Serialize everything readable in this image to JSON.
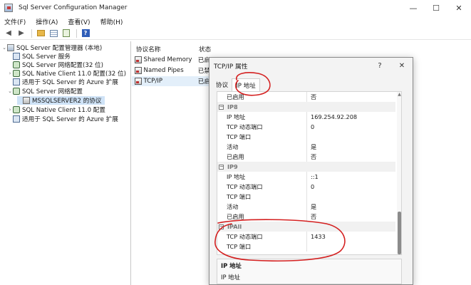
{
  "window": {
    "title": "Sql Server Configuration Manager",
    "minimize": "—",
    "maximize": "☐",
    "close": "✕"
  },
  "menu": [
    "文件(F)",
    "操作(A)",
    "查看(V)",
    "帮助(H)"
  ],
  "tree": {
    "items": [
      {
        "label": "SQL Server 配置管理器 (本地)",
        "indent": 0,
        "expander": "⌄",
        "icon": "root"
      },
      {
        "label": "SQL Server 服务",
        "indent": 1,
        "expander": "",
        "icon": "svc"
      },
      {
        "label": "SQL Server 网络配置(32 位)",
        "indent": 1,
        "expander": "",
        "icon": "net"
      },
      {
        "label": "SQL Native Client 11.0 配置(32 位)",
        "indent": 1,
        "expander": "›",
        "icon": "net"
      },
      {
        "label": "适用于 SQL Server 的 Azure 扩展",
        "indent": 1,
        "expander": "",
        "icon": "svc"
      },
      {
        "label": "SQL Server 网络配置",
        "indent": 1,
        "expander": "⌄",
        "icon": "net"
      },
      {
        "label": "MSSQLSERVER2 的协议",
        "indent": 2,
        "expander": "",
        "icon": "proto",
        "selected": true
      },
      {
        "label": "SQL Native Client 11.0 配置",
        "indent": 1,
        "expander": "›",
        "icon": "net"
      },
      {
        "label": "适用于 SQL Server 的 Azure 扩展",
        "indent": 1,
        "expander": "",
        "icon": "svc"
      }
    ]
  },
  "list": {
    "headers": {
      "name": "协议名称",
      "status": "状态"
    },
    "rows": [
      {
        "name": "Shared Memory",
        "status": "已启"
      },
      {
        "name": "Named Pipes",
        "status": "已禁"
      },
      {
        "name": "TCP/IP",
        "status": "已启"
      }
    ]
  },
  "dialog": {
    "title": "TCP/IP 属性",
    "help": "?",
    "close": "✕",
    "tabs": [
      "协议",
      "IP 地址"
    ],
    "grid": [
      {
        "type": "prop",
        "name": "已启用",
        "value": "否"
      },
      {
        "type": "cat",
        "name": "IP8",
        "toggle": "⊟"
      },
      {
        "type": "prop",
        "name": "IP 地址",
        "value": "169.254.92.208"
      },
      {
        "type": "prop",
        "name": "TCP 动态端口",
        "value": "0"
      },
      {
        "type": "prop",
        "name": "TCP 端口",
        "value": ""
      },
      {
        "type": "prop",
        "name": "活动",
        "value": "是"
      },
      {
        "type": "prop",
        "name": "已启用",
        "value": "否"
      },
      {
        "type": "cat",
        "name": "IP9",
        "toggle": "⊟"
      },
      {
        "type": "prop",
        "name": "IP 地址",
        "value": "::1"
      },
      {
        "type": "prop",
        "name": "TCP 动态端口",
        "value": "0"
      },
      {
        "type": "prop",
        "name": "TCP 端口",
        "value": ""
      },
      {
        "type": "prop",
        "name": "活动",
        "value": "是"
      },
      {
        "type": "prop",
        "name": "已启用",
        "value": "否"
      },
      {
        "type": "cat",
        "name": "IPAll",
        "toggle": "⊟"
      },
      {
        "type": "prop",
        "name": "TCP 动态端口",
        "value": "1433"
      },
      {
        "type": "prop",
        "name": "TCP 端口",
        "value": ""
      }
    ],
    "description": {
      "title": "IP 地址",
      "text": "IP 地址"
    }
  },
  "colors": {
    "annotation": "#d42020",
    "selection": "#cfe3f7"
  }
}
